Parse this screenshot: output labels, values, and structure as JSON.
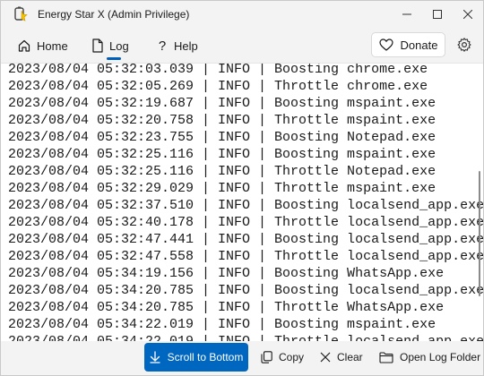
{
  "window": {
    "title": "Energy Star X  (Admin Privilege)"
  },
  "nav": {
    "home_label": "Home",
    "log_label": "Log",
    "help_label": "Help",
    "donate_label": "Donate",
    "active_tab": "Log"
  },
  "log": {
    "entries": [
      "2023/08/04 05:32:03.039 | INFO | Boosting chrome.exe",
      "2023/08/04 05:32:05.269 | INFO | Throttle chrome.exe",
      "2023/08/04 05:32:19.687 | INFO | Boosting mspaint.exe",
      "2023/08/04 05:32:20.758 | INFO | Throttle mspaint.exe",
      "2023/08/04 05:32:23.755 | INFO | Boosting Notepad.exe",
      "2023/08/04 05:32:25.116 | INFO | Boosting mspaint.exe",
      "2023/08/04 05:32:25.116 | INFO | Throttle Notepad.exe",
      "2023/08/04 05:32:29.029 | INFO | Throttle mspaint.exe",
      "2023/08/04 05:32:37.510 | INFO | Boosting localsend_app.exe",
      "2023/08/04 05:32:40.178 | INFO | Throttle localsend_app.exe",
      "2023/08/04 05:32:47.441 | INFO | Boosting localsend_app.exe",
      "2023/08/04 05:32:47.558 | INFO | Throttle localsend_app.exe",
      "2023/08/04 05:34:19.156 | INFO | Boosting WhatsApp.exe",
      "2023/08/04 05:34:20.785 | INFO | Boosting localsend_app.exe",
      "2023/08/04 05:34:20.785 | INFO | Throttle WhatsApp.exe",
      "2023/08/04 05:34:22.019 | INFO | Boosting mspaint.exe",
      "2023/08/04 05:34:22.019 | INFO | Throttle localsend_app.exe"
    ]
  },
  "toolbar": {
    "scroll_bottom_label": "Scroll to Bottom",
    "copy_label": "Copy",
    "clear_label": "Clear",
    "open_folder_label": "Open Log Folder"
  },
  "colors": {
    "accent": "#0067c0",
    "nav_indicator": "#005fb8",
    "app_icon": "#e8b000"
  }
}
